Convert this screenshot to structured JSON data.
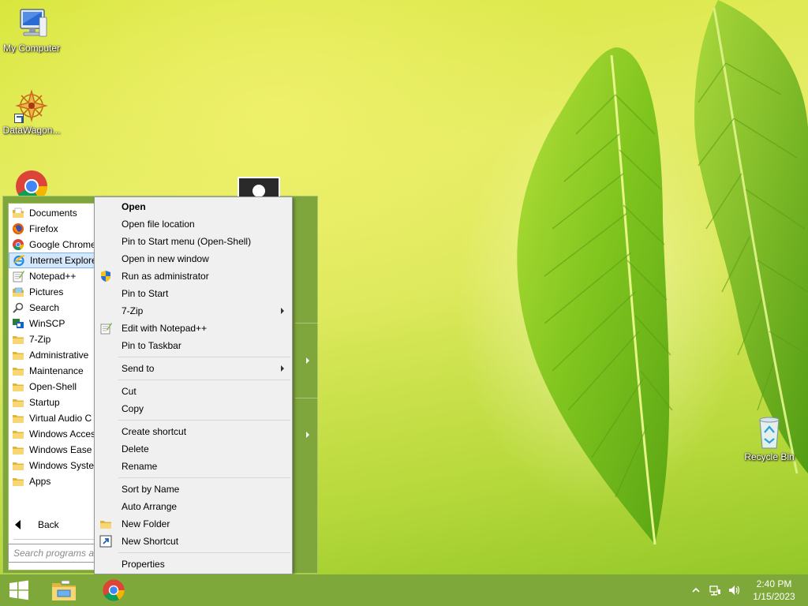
{
  "desktop": {
    "icons": [
      {
        "label": "My Computer"
      },
      {
        "label": "DataWagon..."
      },
      {
        "label": "Recycle Bin"
      }
    ]
  },
  "start_menu": {
    "programs": [
      {
        "label": "Documents",
        "icon": "documents-icon"
      },
      {
        "label": "Firefox",
        "icon": "firefox-icon"
      },
      {
        "label": "Google Chrome",
        "icon": "chrome-icon"
      },
      {
        "label": "Internet Explorer",
        "icon": "ie-icon",
        "selected": true
      },
      {
        "label": "Notepad++",
        "icon": "notepadpp-icon"
      },
      {
        "label": "Pictures",
        "icon": "pictures-icon"
      },
      {
        "label": "Search",
        "icon": "search-icon"
      },
      {
        "label": "WinSCP",
        "icon": "winscp-icon"
      },
      {
        "label": "7-Zip",
        "icon": "folder-icon"
      },
      {
        "label": "Administrative",
        "icon": "folder-icon"
      },
      {
        "label": "Maintenance",
        "icon": "folder-icon"
      },
      {
        "label": "Open-Shell",
        "icon": "folder-icon"
      },
      {
        "label": "Startup",
        "icon": "folder-icon"
      },
      {
        "label": "Virtual Audio C",
        "icon": "folder-icon"
      },
      {
        "label": "Windows Acces",
        "icon": "folder-icon"
      },
      {
        "label": "Windows Ease o",
        "icon": "folder-icon"
      },
      {
        "label": "Windows Syste",
        "icon": "folder-icon"
      },
      {
        "label": "Apps",
        "icon": "folder-icon"
      }
    ],
    "back_label": "Back",
    "search_placeholder": "Search programs a"
  },
  "context_menu": {
    "items": [
      {
        "label": "Open",
        "bold": true
      },
      {
        "label": "Open file location"
      },
      {
        "label": "Pin to Start menu (Open-Shell)"
      },
      {
        "label": "Open in new window"
      },
      {
        "label": "Run as administrator",
        "icon": "uac-shield-icon"
      },
      {
        "label": "Pin to Start"
      },
      {
        "label": "7-Zip",
        "submenu": true
      },
      {
        "label": "Edit with Notepad++",
        "icon": "notepadpp-icon"
      },
      {
        "label": "Pin to Taskbar"
      },
      {
        "sep": true
      },
      {
        "label": "Send to",
        "submenu": true
      },
      {
        "sep": true
      },
      {
        "label": "Cut"
      },
      {
        "label": "Copy"
      },
      {
        "sep": true
      },
      {
        "label": "Create shortcut"
      },
      {
        "label": "Delete"
      },
      {
        "label": "Rename"
      },
      {
        "sep": true
      },
      {
        "label": "Sort by Name"
      },
      {
        "label": "Auto Arrange"
      },
      {
        "label": "New Folder",
        "icon": "folder-icon"
      },
      {
        "label": "New Shortcut",
        "icon": "shortcut-icon"
      },
      {
        "sep": true
      },
      {
        "label": "Properties"
      }
    ]
  },
  "taskbar": {
    "start_icon": "windows-logo-icon",
    "pinned": [
      "file-explorer-icon",
      "chrome-icon"
    ],
    "tray": {
      "time": "2:40 PM",
      "date": "1/15/2023",
      "icons": [
        "show-hidden-icons-chevron",
        "network-icon",
        "volume-icon"
      ]
    }
  },
  "colors": {
    "taskbar": "#7ea93a",
    "start_menu_frame": "#7ea63d",
    "menu_bg": "#f0f0f0",
    "selection": "#d5e8fb"
  }
}
